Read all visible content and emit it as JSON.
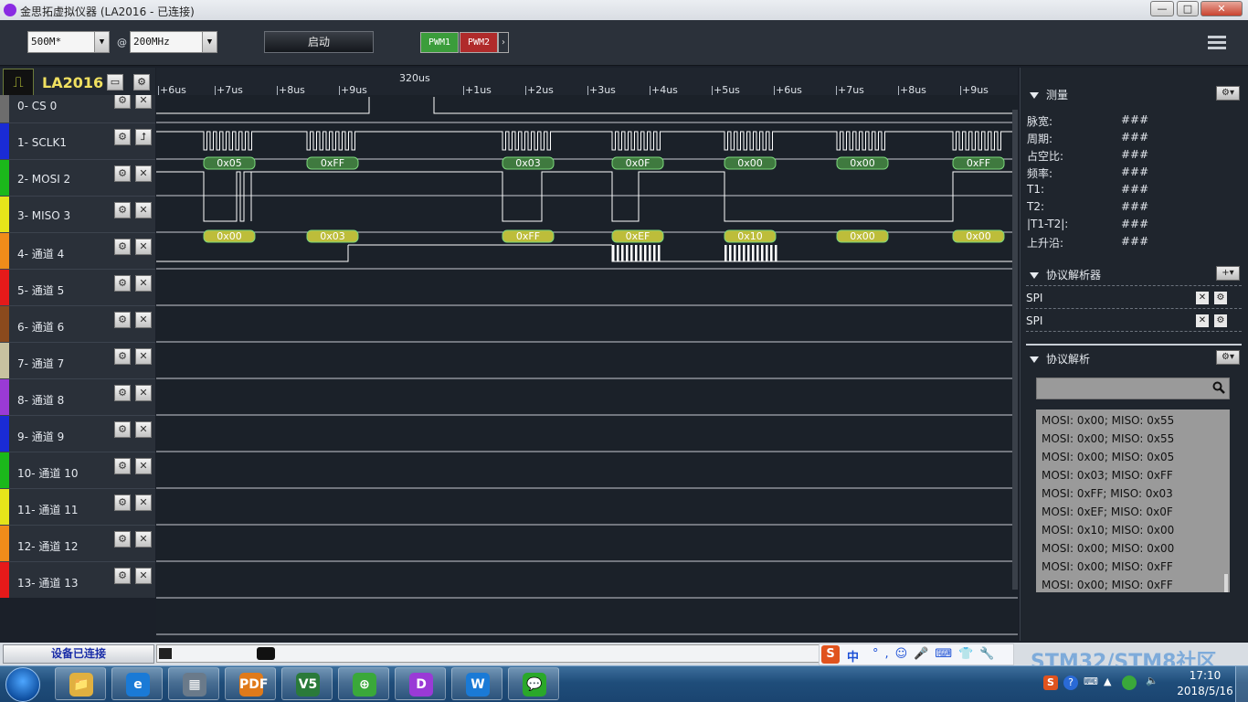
{
  "window": {
    "title": "金思拓虚拟仪器 (LA2016 - 已连接)",
    "minimize": "—",
    "maximize": "□",
    "close": "✕"
  },
  "toolbar": {
    "sample_depth": "500M*",
    "at": "@",
    "sample_rate": "200MHz",
    "start_label": "启动",
    "pwm1": "PWM1",
    "pwm2": "PWM2",
    "pwm_arrow": "›"
  },
  "device": {
    "model": "LA2016"
  },
  "ruler": {
    "marker": "320us",
    "ticks": [
      "+6us",
      "+7us",
      "+8us",
      "+9us",
      "+1us",
      "+2us",
      "+3us",
      "+4us",
      "+5us",
      "+6us",
      "+7us",
      "+8us",
      "+9us"
    ]
  },
  "channels": [
    {
      "label": "0-  CS 0",
      "color": "#6d6d6d"
    },
    {
      "label": "1-  SCLK1",
      "color": "#1a2bd6"
    },
    {
      "label": "2-  MOSI 2",
      "color": "#1bb81b"
    },
    {
      "label": "3-  MISO 3",
      "color": "#e5e51a"
    },
    {
      "label": "4-  通道 4",
      "color": "#f08c1a"
    },
    {
      "label": "5-  通道 5",
      "color": "#e51a1a"
    },
    {
      "label": "6-  通道 6",
      "color": "#8b4a1d"
    },
    {
      "label": "7-  通道 7",
      "color": "#c8c2a0"
    },
    {
      "label": "8-  通道 8",
      "color": "#9a3ad6"
    },
    {
      "label": "9-  通道 9",
      "color": "#1a2bd6"
    },
    {
      "label": "10- 通道 10",
      "color": "#1bb81b"
    },
    {
      "label": "11- 通道 11",
      "color": "#e5e51a"
    },
    {
      "label": "12- 通道 12",
      "color": "#f08c1a"
    },
    {
      "label": "13- 通道 13",
      "color": "#e51a1a"
    }
  ],
  "decode_labels": {
    "mosi": [
      "0x05",
      "0xFF",
      "0x03",
      "0x0F",
      "0x00",
      "0x00",
      "0xFF"
    ],
    "miso": [
      "0x00",
      "0x03",
      "0xFF",
      "0xEF",
      "0x10",
      "0x00",
      "0x00"
    ]
  },
  "measure": {
    "title": "测量",
    "rows": [
      {
        "label": "脉宽:",
        "value": "###"
      },
      {
        "label": "周期:",
        "value": "###"
      },
      {
        "label": "占空比:",
        "value": "###"
      },
      {
        "label": "频率:",
        "value": "###"
      },
      {
        "label": "T1:",
        "value": "###"
      },
      {
        "label": "T2:",
        "value": "###"
      },
      {
        "label": "|T1-T2|:",
        "value": "###"
      },
      {
        "label": "上升沿:",
        "value": "###"
      }
    ]
  },
  "analyzers": {
    "title": "协议解析器",
    "add": "+",
    "items": [
      "SPI",
      "SPI"
    ]
  },
  "decode": {
    "title": "协议解析",
    "search_placeholder": "",
    "rows": [
      "MOSI: 0x00;  MISO: 0x55",
      "MOSI: 0x00;  MISO: 0x55",
      "MOSI: 0x00;  MISO: 0x05",
      "MOSI: 0x03;  MISO: 0xFF",
      "MOSI: 0xFF;  MISO: 0x03",
      "MOSI: 0xEF;  MISO: 0x0F",
      "MOSI: 0x10;  MISO: 0x00",
      "MOSI: 0x00;  MISO: 0x00",
      "MOSI: 0x00;  MISO: 0xFF",
      "MOSI: 0x00;  MISO: 0xFF"
    ]
  },
  "status": {
    "connection": "设备已连接"
  },
  "ime": {
    "logo": "S",
    "mode": "中",
    "icons": "°,☺🎤⌨👕🔧"
  },
  "watermark": "STM32/STM8社区",
  "taskbar": {
    "apps": [
      {
        "name": "explorer",
        "glyph": "📁",
        "color": "#e0b040"
      },
      {
        "name": "ie",
        "glyph": "e",
        "color": "#1a7ad6"
      },
      {
        "name": "calculator",
        "glyph": "▦",
        "color": "#6a7a8a"
      },
      {
        "name": "pdf",
        "glyph": "PDF",
        "color": "#e07a1a"
      },
      {
        "name": "v5",
        "glyph": "V5",
        "color": "#2a7a3a"
      },
      {
        "name": "360",
        "glyph": "⊕",
        "color": "#3aa83a"
      },
      {
        "name": "logic",
        "glyph": "D",
        "color": "#9a3ad6"
      },
      {
        "name": "wps",
        "glyph": "W",
        "color": "#1a7ad6"
      },
      {
        "name": "wechat",
        "glyph": "💬",
        "color": "#2aa82a"
      }
    ],
    "time": "17:10",
    "date": "2018/5/16"
  }
}
